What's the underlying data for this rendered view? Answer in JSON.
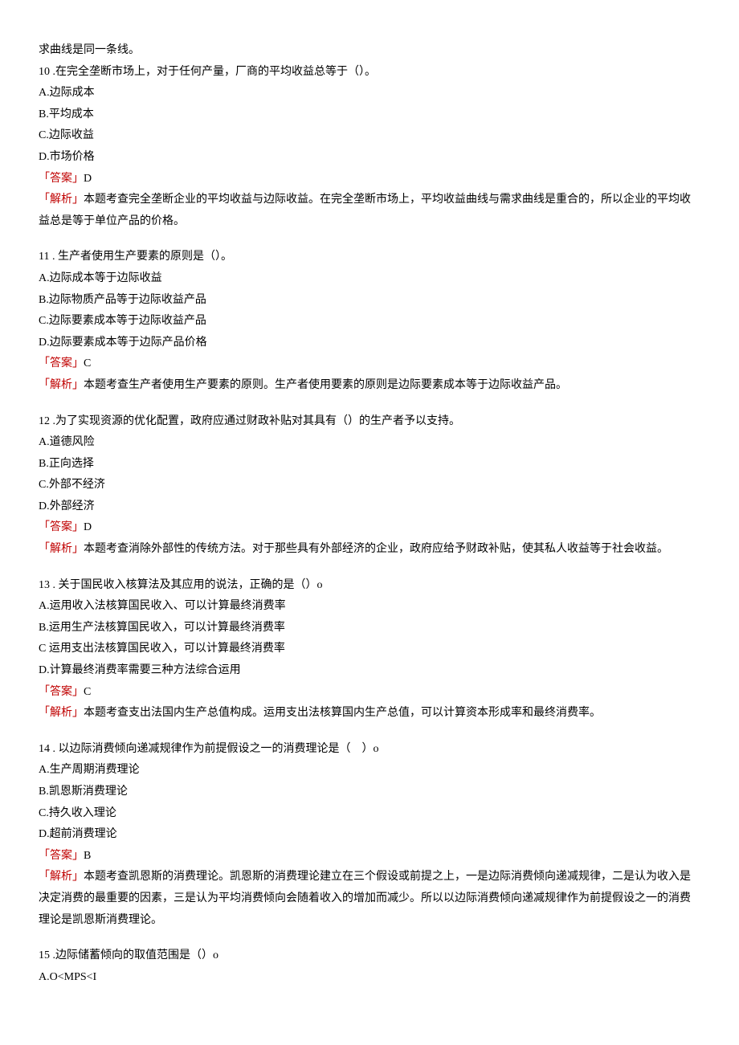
{
  "intro_trail": "求曲线是同一条线。",
  "questions": [
    {
      "num": "10",
      "stem": ".在完全垄断市场上，对于任何产量，厂商的平均收益总等于（）。",
      "options": [
        "A.边际成本",
        "B.平均成本",
        "C.边际收益",
        "D.市场价格"
      ],
      "answer_label": "「答案」",
      "answer_value": "D",
      "analysis_label": "「解析」",
      "analysis_text": "本题考查完全垄断企业的平均收益与边际收益。在完全垄断市场上，平均收益曲线与需求曲线是重合的，所以企业的平均收益总是等于单位产品的价格。"
    },
    {
      "num": "11",
      "stem": ". 生产者使用生产要素的原则是（）。",
      "options": [
        "A.边际成本等于边际收益",
        "B.边际物质产品等于边际收益产品",
        "C.边际要素成本等于边际收益产品",
        "D.边际要素成本等于边际产品价格"
      ],
      "answer_label": "「答案」",
      "answer_value": "C",
      "analysis_label": "「解析」",
      "analysis_text": "本题考查生产者使用生产要素的原则。生产者使用要素的原则是边际要素成本等于边际收益产品。"
    },
    {
      "num": "12",
      "stem": ".为了实现资源的优化配置，政府应通过财政补贴对其具有（）的生产者予以支持。",
      "options": [
        "A.道德风险",
        "B.正向选择",
        "C.外部不经济",
        "D.外部经济"
      ],
      "answer_label": "「答案」",
      "answer_value": "D",
      "analysis_label": "「解析」",
      "analysis_text": "本题考查消除外部性的传统方法。对于那些具有外部经济的企业，政府应给予财政补贴，使其私人收益等于社会收益。"
    },
    {
      "num": "13",
      "stem": ". 关于国民收入核算法及其应用的说法，正确的是（）o",
      "options": [
        "A.运用收入法核算国民收入、可以计算最终消费率",
        "B.运用生产法核算国民收入，可以计算最终消费率",
        "C 运用支出法核算国民收入，可以计算最终消费率",
        "D.计算最终消费率需要三种方法综合运用"
      ],
      "answer_label": "「答案」",
      "answer_value": "C",
      "analysis_label": "「解析」",
      "analysis_text": "本题考查支出法国内生产总值构成。运用支出法核算国内生产总值，可以计算资本形成率和最终消费率。"
    },
    {
      "num": "14",
      "stem": ". 以边际消费倾向递减规律作为前提假设之一的消费理论是（　）o",
      "options": [
        "A.生产周期消费理论",
        "B.凯恩斯消费理论",
        "C.持久收入理论",
        "D.超前消费理论"
      ],
      "answer_label": "「答案」",
      "answer_value": "B",
      "analysis_label": "「解析」",
      "analysis_text": "本题考查凯恩斯的消费理论。凯恩斯的消费理论建立在三个假设或前提之上，一是边际消费倾向递减规律，二是认为收入是决定消费的最重要的因素，三是认为平均消费倾向会随着收入的增加而减少。所以以边际消费倾向递减规律作为前提假设之一的消费理论是凯恩斯消费理论。"
    }
  ],
  "trailing": {
    "num": "15",
    "stem": ".边际储蓄倾向的取值范围是（）o",
    "option": "A.O<MPS<I"
  }
}
